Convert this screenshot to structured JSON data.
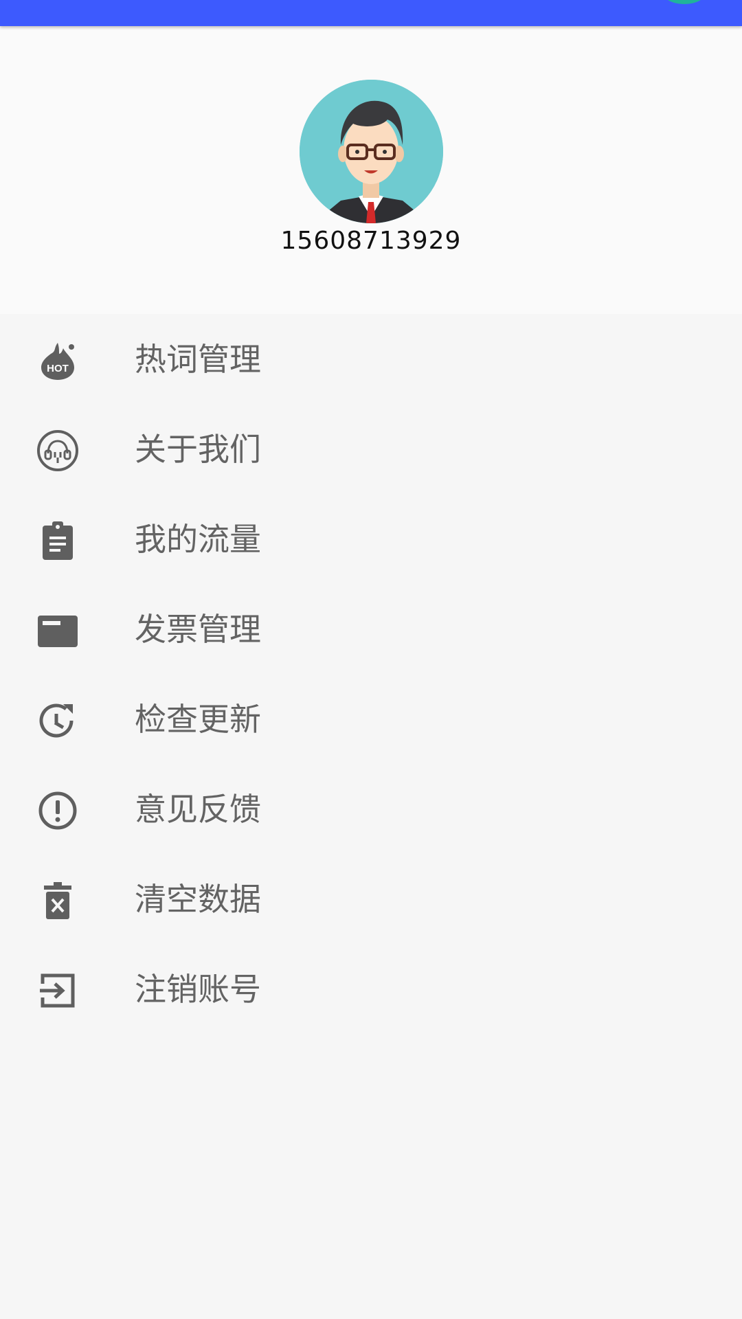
{
  "profile": {
    "phone": "15608713929"
  },
  "menu": {
    "items": [
      {
        "label": "热词管理",
        "icon": "hot-icon"
      },
      {
        "label": "关于我们",
        "icon": "support-headset-icon"
      },
      {
        "label": "我的流量",
        "icon": "clipboard-icon"
      },
      {
        "label": "发票管理",
        "icon": "invoice-card-icon"
      },
      {
        "label": "检查更新",
        "icon": "update-clock-icon"
      },
      {
        "label": "意见反馈",
        "icon": "feedback-alert-icon"
      },
      {
        "label": "清空数据",
        "icon": "trash-icon"
      },
      {
        "label": "注销账号",
        "icon": "logout-icon"
      }
    ]
  },
  "colors": {
    "topbar": "#3d5afe",
    "accent_dot": "#20b39a",
    "icon": "#5f5f5f",
    "label": "#636363",
    "background": "#f6f6f6",
    "header_bg": "#fafafa",
    "avatar_bg": "#6fcbd0"
  }
}
